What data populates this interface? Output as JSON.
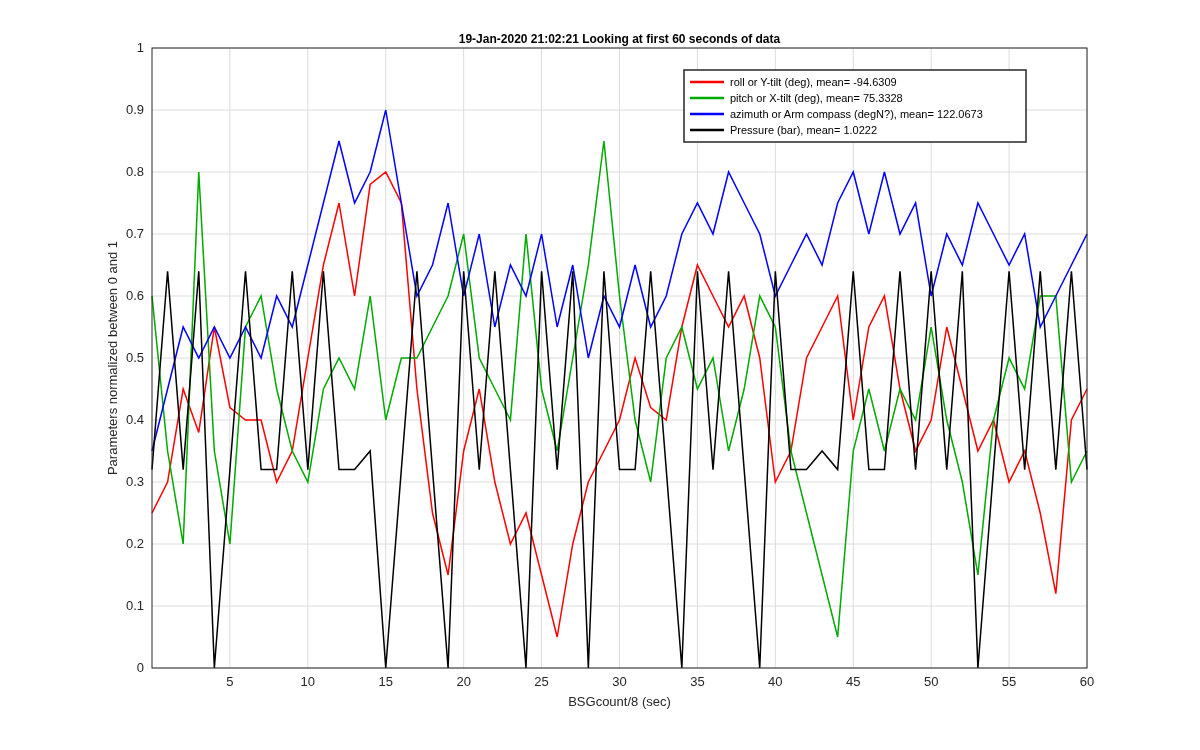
{
  "chart_data": {
    "type": "line",
    "title": "19-Jan-2020 21:02:21 Looking at first 60 seconds of data",
    "xlabel": "BSGcount/8 (sec)",
    "ylabel": "Parameters normalized between 0 and 1",
    "x": [
      0,
      1,
      2,
      3,
      4,
      5,
      6,
      7,
      8,
      9,
      10,
      11,
      12,
      13,
      14,
      15,
      16,
      17,
      18,
      19,
      20,
      21,
      22,
      23,
      24,
      25,
      26,
      27,
      28,
      29,
      30,
      31,
      32,
      33,
      34,
      35,
      36,
      37,
      38,
      39,
      40,
      41,
      42,
      43,
      44,
      45,
      46,
      47,
      48,
      49,
      50,
      51,
      52,
      53,
      54,
      55,
      56,
      57,
      58,
      59,
      60
    ],
    "series": [
      {
        "name": "roll or Y-tilt (deg), mean= -94.6309",
        "color": "#ff0000",
        "values": [
          0.25,
          0.3,
          0.45,
          0.38,
          0.55,
          0.42,
          0.4,
          0.4,
          0.3,
          0.35,
          0.5,
          0.65,
          0.75,
          0.6,
          0.78,
          0.8,
          0.75,
          0.45,
          0.25,
          0.15,
          0.35,
          0.45,
          0.3,
          0.2,
          0.25,
          0.15,
          0.05,
          0.2,
          0.3,
          0.35,
          0.4,
          0.5,
          0.42,
          0.4,
          0.55,
          0.65,
          0.6,
          0.55,
          0.6,
          0.5,
          0.3,
          0.35,
          0.5,
          0.55,
          0.6,
          0.4,
          0.55,
          0.6,
          0.45,
          0.35,
          0.4,
          0.55,
          0.45,
          0.35,
          0.4,
          0.3,
          0.35,
          0.25,
          0.12,
          0.4,
          0.45
        ]
      },
      {
        "name": "pitch or X-tilt (deg), mean= 75.3328",
        "color": "#00aa00",
        "values": [
          0.6,
          0.35,
          0.2,
          0.8,
          0.35,
          0.2,
          0.55,
          0.6,
          0.45,
          0.35,
          0.3,
          0.45,
          0.5,
          0.45,
          0.6,
          0.4,
          0.5,
          0.5,
          0.55,
          0.6,
          0.7,
          0.5,
          0.45,
          0.4,
          0.7,
          0.45,
          0.35,
          0.5,
          0.65,
          0.85,
          0.6,
          0.4,
          0.3,
          0.5,
          0.55,
          0.45,
          0.5,
          0.35,
          0.45,
          0.6,
          0.55,
          0.35,
          0.25,
          0.15,
          0.05,
          0.35,
          0.45,
          0.35,
          0.45,
          0.4,
          0.55,
          0.4,
          0.3,
          0.15,
          0.4,
          0.5,
          0.45,
          0.6,
          0.6,
          0.3,
          0.35
        ]
      },
      {
        "name": "azimuth or Arm compass (degN?), mean= 122.0673",
        "color": "#0000ff",
        "values": [
          0.35,
          0.45,
          0.55,
          0.5,
          0.55,
          0.5,
          0.55,
          0.5,
          0.6,
          0.55,
          0.65,
          0.75,
          0.85,
          0.75,
          0.8,
          0.9,
          0.75,
          0.6,
          0.65,
          0.75,
          0.6,
          0.7,
          0.55,
          0.65,
          0.6,
          0.7,
          0.55,
          0.65,
          0.5,
          0.6,
          0.55,
          0.65,
          0.55,
          0.6,
          0.7,
          0.75,
          0.7,
          0.8,
          0.75,
          0.7,
          0.6,
          0.65,
          0.7,
          0.65,
          0.75,
          0.8,
          0.7,
          0.8,
          0.7,
          0.75,
          0.6,
          0.7,
          0.65,
          0.75,
          0.7,
          0.65,
          0.7,
          0.55,
          0.6,
          0.65,
          0.7
        ]
      },
      {
        "name": "Pressure (bar), mean= 1.0222",
        "color": "#000000",
        "values": [
          0.32,
          0.64,
          0.32,
          0.64,
          0.0,
          0.32,
          0.64,
          0.32,
          0.32,
          0.64,
          0.32,
          0.64,
          0.32,
          0.32,
          0.35,
          0.0,
          0.32,
          0.64,
          0.32,
          0.0,
          0.64,
          0.32,
          0.64,
          0.32,
          0.0,
          0.64,
          0.32,
          0.64,
          0.0,
          0.64,
          0.32,
          0.32,
          0.64,
          0.32,
          0.0,
          0.64,
          0.32,
          0.64,
          0.32,
          0.0,
          0.64,
          0.32,
          0.32,
          0.35,
          0.32,
          0.64,
          0.32,
          0.32,
          0.64,
          0.32,
          0.64,
          0.32,
          0.64,
          0.0,
          0.32,
          0.64,
          0.32,
          0.64,
          0.32,
          0.64,
          0.32
        ]
      }
    ],
    "grid": true,
    "legend": true,
    "xlim": [
      0,
      60
    ],
    "ylim": [
      0,
      1
    ],
    "xticks": [
      5,
      10,
      15,
      20,
      25,
      30,
      35,
      40,
      45,
      50,
      55,
      60
    ],
    "yticks": [
      0,
      0.1,
      0.2,
      0.3,
      0.4,
      0.5,
      0.6,
      0.7,
      0.8,
      0.9,
      1
    ]
  }
}
